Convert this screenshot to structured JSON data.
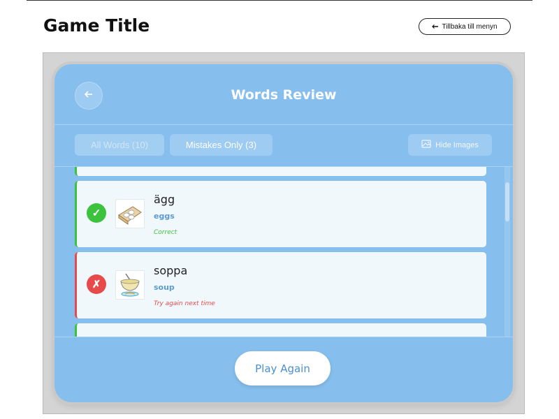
{
  "page": {
    "title": "Game Title",
    "back_to_menu": "Tillbaka till menyn"
  },
  "review": {
    "title": "Words Review",
    "tabs": {
      "all": "All Words (10)",
      "mistakes": "Mistakes Only (3)",
      "hide_images": "Hide Images"
    },
    "items": [
      {
        "word": "ägg",
        "translation": "eggs",
        "status": "correct",
        "result": "Correct",
        "icon": "check-icon"
      },
      {
        "word": "soppa",
        "translation": "soup",
        "status": "incorrect",
        "result": "Try again next time",
        "icon": "x-icon"
      }
    ],
    "play_again": "Play Again"
  },
  "colors": {
    "panel": "#86bfed",
    "correct": "#3dc23d",
    "incorrect": "#e64a4a",
    "accent": "#4a90cf"
  }
}
